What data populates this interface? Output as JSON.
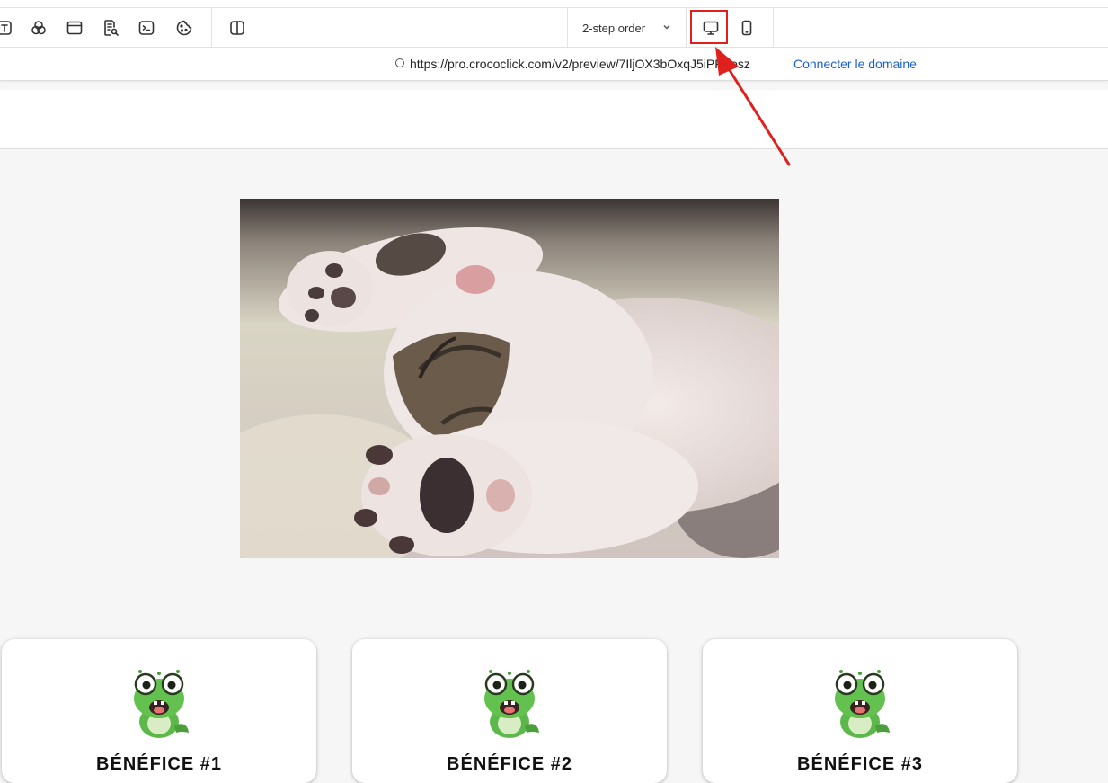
{
  "toolbar": {
    "tools": [
      "text-tool",
      "color-tool",
      "layout-tool",
      "seo-tool",
      "code-tool",
      "cookie-tool",
      "split-view-tool"
    ],
    "page_select": {
      "selected": "2-step order"
    },
    "devices": [
      "desktop",
      "mobile"
    ],
    "active_device": "desktop"
  },
  "urlbar": {
    "url": "https://pro.crococlick.com/v2/preview/7IljOX3bOxqJ5iPRgesz",
    "connect_label": "Connecter le domaine"
  },
  "cards": [
    {
      "title": "BÉNÉFICE #1"
    },
    {
      "title": "BÉNÉFICE #2"
    },
    {
      "title": "BÉNÉFICE #3"
    }
  ],
  "colors": {
    "accent_link": "#1a5fd0",
    "highlight_red": "#e0201c",
    "mascot_green": "#5cb84a"
  }
}
